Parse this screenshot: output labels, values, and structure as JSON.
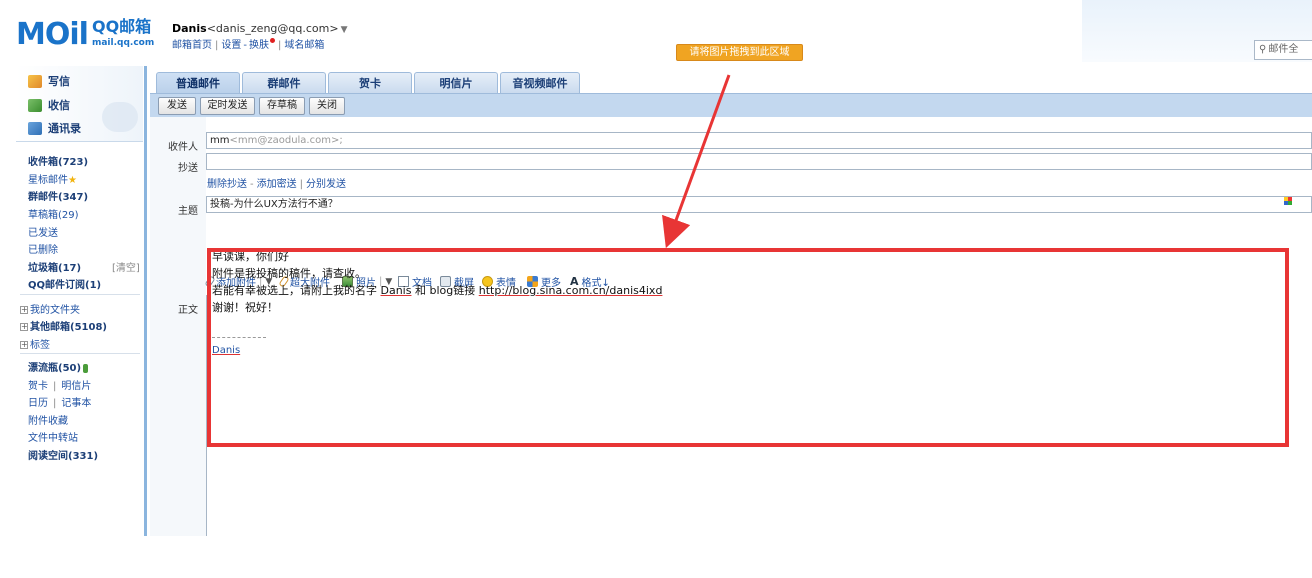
{
  "header": {
    "logo_mail": "MOil",
    "logo_qq": "QQ邮箱",
    "logo_url": "mail.qq.com",
    "user_name": "Danis",
    "user_email": "<danis_zeng@qq.com>",
    "dropdown_arrow": "▼",
    "links": [
      "邮箱首页",
      "设置",
      "换肤",
      "域名邮箱"
    ],
    "link_sep": "|",
    "link_dash": "-",
    "drop_banner": "请将图片拖拽到此区域",
    "search_placeholder": "邮件全"
  },
  "sidebar": {
    "actions": [
      {
        "label": "写信",
        "icon": "compose-icon"
      },
      {
        "label": "收信",
        "icon": "inbox-icon"
      },
      {
        "label": "通讯录",
        "icon": "contacts-icon"
      }
    ],
    "folders": [
      {
        "label": "收件箱(723)",
        "bold": true
      },
      {
        "label": "星标邮件",
        "star": "★"
      },
      {
        "label": "群邮件(347)",
        "bold": true
      },
      {
        "label": "草稿箱(29)"
      },
      {
        "label": "已发送"
      },
      {
        "label": "已删除"
      },
      {
        "label": "垃圾箱(17)",
        "bold": true,
        "extra": "[清空]"
      },
      {
        "label": "QQ邮件订阅(1)",
        "bold": true
      }
    ],
    "trees": [
      {
        "label": "我的文件夹",
        "bold": false
      },
      {
        "label": "其他邮箱(5108)",
        "bold": true
      },
      {
        "label": "标签",
        "bold": false
      }
    ],
    "tree_toggle": "+",
    "apps": {
      "drift": "漂流瓶(50)",
      "card": "贺卡",
      "postcard": "明信片",
      "calendar": "日历",
      "notes": "记事本",
      "attachments": "附件收藏",
      "transfer": "文件中转站",
      "reading": "阅读空间(331)",
      "sep": "|"
    }
  },
  "tabs": [
    "普通邮件",
    "群邮件",
    "贺卡",
    "明信片",
    "音视频邮件"
  ],
  "toolbar": {
    "send": "发送",
    "timed_send": "定时发送",
    "save_draft": "存草稿",
    "close": "关闭"
  },
  "compose": {
    "to_label": "收件人",
    "to_value": "mm",
    "to_hint": "<mm@zaodula.com>;",
    "cc_label": "抄送",
    "cc_links": [
      "删除抄送",
      "添加密送",
      "分别发送"
    ],
    "link_dash": "-",
    "link_sep": "|",
    "subject_label": "主题",
    "subject_value": "投稿-为什么UX方法行不通？",
    "body_label": "正文",
    "editor_tools": [
      {
        "label": "添加附件",
        "icon": "paperclip-icon",
        "dropdown": true
      },
      {
        "label": "超大附件",
        "icon": "paperclip-large-icon",
        "dropdown": false
      },
      {
        "label": "照片",
        "icon": "photo-icon",
        "dropdown": true
      },
      {
        "label": "文档",
        "icon": "document-icon",
        "dropdown": false
      },
      {
        "label": "截屏",
        "icon": "screenshot-icon",
        "dropdown": false
      },
      {
        "label": "表情",
        "icon": "emoji-icon",
        "dropdown": false
      },
      {
        "label": "更多",
        "icon": "more-icon",
        "dropdown": false
      },
      {
        "label": "格式↓",
        "icon": "format-icon",
        "dropdown": false
      }
    ],
    "tool_arrow": "▼",
    "tool_sep": "|",
    "body_lines": [
      "早读课，你们好",
      "附件是我投稿的稿件，请查收。",
      "若能有幸被选上，请附上我的名字 Danis 和 blog链接 http://blog.sina.com.cn/danis4ixd",
      "谢谢！祝好！"
    ],
    "signature": "Danis"
  },
  "colors": {
    "accent": "#1a73c9",
    "toolbar_bg": "#c3d8ef",
    "highlight": "#e83535",
    "banner": "#f0a422"
  }
}
